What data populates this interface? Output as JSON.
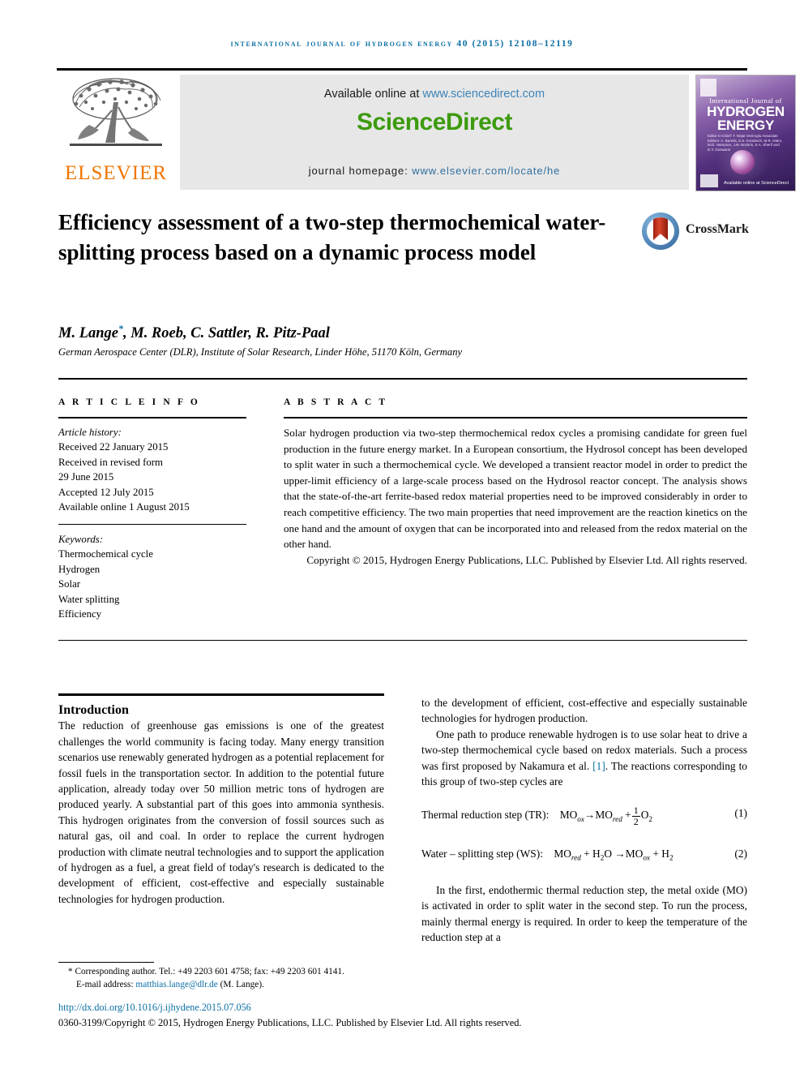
{
  "running_head": "International Journal of Hydrogen Energy 40 (2015) 12108–12119",
  "masthead": {
    "available_prefix": "Available online at ",
    "available_url": "www.sciencedirect.com",
    "sciencedirect_logo": "ScienceDirect",
    "homepage_prefix": "journal homepage: ",
    "homepage_url": "www.elsevier.com/locate/he",
    "elsevier_wordmark": "ELSEVIER",
    "elsevier_orange": "#ee7600",
    "sciencedirect_green": "#3d9b0e",
    "link_blue": "#3d84b8"
  },
  "cover": {
    "line_small": "International Journal of",
    "line_big_1": "HYDROGEN",
    "line_big_2": "ENERGY",
    "editors": "Editor-in-Chief: T. Nejat Veziroglu   Associate Editors: A. Bartels, E.E. Kordesch, M.R. Islam, M.D. Hampton, J.M. Bockris, S.A. Sherif and D.Y. Goswami",
    "bottom_text": "Available online at ScienceDirect"
  },
  "crossmark": {
    "label": "CrossMark"
  },
  "article": {
    "title": "Efficiency assessment of a two-step thermochemical water-splitting process based on a dynamic process model",
    "authors": "M. Lange",
    "authors_rest": ", M. Roeb, C. Sattler, R. Pitz-Paal",
    "corresponding_marker": "*",
    "affiliation": "German Aerospace Center (DLR), Institute of Solar Research, Linder Höhe, 51170 Köln, Germany"
  },
  "sections": {
    "article_info_heading": "A R T I C L E   I N F O",
    "abstract_heading": "A B S T R A C T"
  },
  "article_info": {
    "history_label": "Article history:",
    "history": [
      "Received 22 January 2015",
      "Received in revised form",
      "29 June 2015",
      "Accepted 12 July 2015",
      "Available online 1 August 2015"
    ],
    "keywords_label": "Keywords:",
    "keywords": [
      "Thermochemical cycle",
      "Hydrogen",
      "Solar",
      "Water splitting",
      "Efficiency"
    ]
  },
  "abstract": {
    "body": "Solar hydrogen production via two-step thermochemical redox cycles a promising candidate for green fuel production in the future energy market. In a European consortium, the Hydrosol concept has been developed to split water in such a thermochemical cycle. We developed a transient reactor model in order to predict the upper-limit efficiency of a large-scale process based on the Hydrosol reactor concept. The analysis shows that the state-of-the-art ferrite-based redox material properties need to be improved considerably in order to reach competitive efficiency. The two main properties that need improvement are the reaction kinetics on the one hand and the amount of oxygen that can be incorporated into and released from the redox material on the other hand.",
    "copyright": "Copyright © 2015, Hydrogen Energy Publications, LLC. Published by Elsevier Ltd. All rights reserved."
  },
  "introduction": {
    "heading": "Introduction",
    "para1": "The reduction of greenhouse gas emissions is one of the greatest challenges the world community is facing today. Many energy transition scenarios use renewably generated hydrogen as a potential replacement for fossil fuels in the transportation sector. In addition to the potential future application, already today over 50 million metric tons of hydrogen are produced yearly. A substantial part of this goes into ammonia synthesis. This hydrogen originates from the conversion of fossil sources such as natural gas, oil and coal. In order to replace the current hydrogen production with climate neutral technologies and to support the application of hydrogen as a fuel, a great field of today's research is dedicated to the development of efficient, cost-effective and especially sustainable technologies for hydrogen production.",
    "para2_before_ref": "One path to produce renewable hydrogen is to use solar heat to drive a two-step thermochemical cycle based on redox materials. Such a process was first proposed by Nakamura et al. ",
    "para2_ref": "[1]",
    "para2_after_ref": ". The reactions corresponding to this group of two-step cycles are",
    "para3": "In the first, endothermic thermal reduction step, the metal oxide (MO) is activated in order to split water in the second step. To run the process, mainly thermal energy is required. In order to keep the temperature of the reduction step at a"
  },
  "equations": [
    {
      "label": "Thermal reduction step (TR):",
      "lhs": "MO",
      "lhs_sub": "ox",
      "arrow": "→",
      "rhs": "MO",
      "rhs_sub": "red",
      "plus": "+",
      "frac_num": "1",
      "frac_den": "2",
      "species": "O",
      "species_sub": "2",
      "number": "(1)"
    },
    {
      "label": "Water – splitting step (WS):",
      "lhs": "MO",
      "lhs_sub": "red",
      "plus1": "+ H",
      "plus1_sub": "2",
      "plus1_tail": "O",
      "arrow": "→",
      "rhs": "MO",
      "rhs_sub": "ox",
      "plus2": "+ H",
      "plus2_sub": "2",
      "number": "(2)"
    }
  ],
  "footer": {
    "corresponding": "* Corresponding author. Tel.: +49 2203 601 4758; fax: +49 2203 601 4141.",
    "email_label": "E-mail address: ",
    "email": "matthias.lange@dlr.de",
    "email_suffix": " (M. Lange).",
    "doi": "http://dx.doi.org/10.1016/j.ijhydene.2015.07.056",
    "issn": "0360-3199/Copyright © 2015, Hydrogen Energy Publications, LLC. Published by Elsevier Ltd. All rights reserved."
  }
}
